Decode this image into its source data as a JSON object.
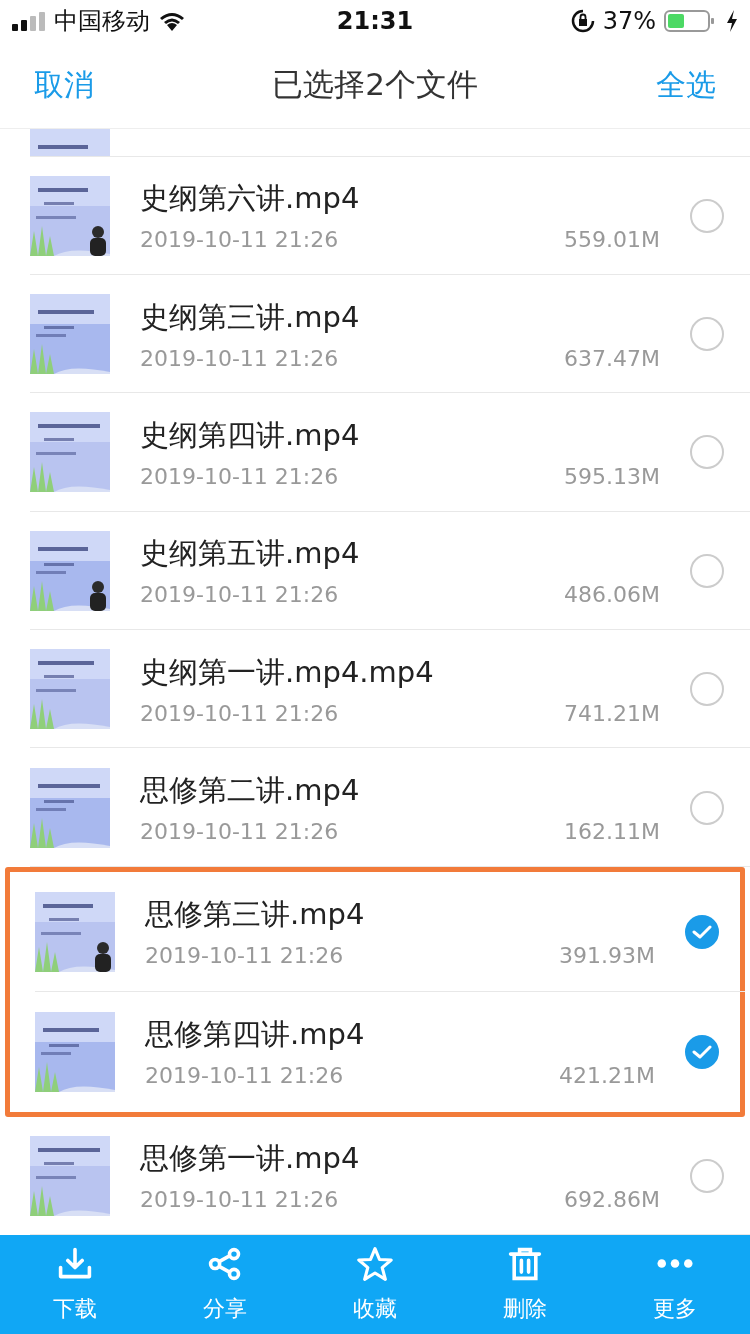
{
  "status_bar": {
    "carrier": "中国移动",
    "time": "21:31",
    "battery": "37%"
  },
  "nav": {
    "cancel": "取消",
    "title": "已选择2个文件",
    "select_all": "全选"
  },
  "files": [
    {
      "name": "史纲第六讲.mp4",
      "date": "2019-10-11 21:26",
      "size": "559.01M",
      "selected": false,
      "highlighted": false
    },
    {
      "name": "史纲第三讲.mp4",
      "date": "2019-10-11 21:26",
      "size": "637.47M",
      "selected": false,
      "highlighted": false
    },
    {
      "name": "史纲第四讲.mp4",
      "date": "2019-10-11 21:26",
      "size": "595.13M",
      "selected": false,
      "highlighted": false
    },
    {
      "name": "史纲第五讲.mp4",
      "date": "2019-10-11 21:26",
      "size": "486.06M",
      "selected": false,
      "highlighted": false
    },
    {
      "name": "史纲第一讲.mp4.mp4",
      "date": "2019-10-11 21:26",
      "size": "741.21M",
      "selected": false,
      "highlighted": false
    },
    {
      "name": "思修第二讲.mp4",
      "date": "2019-10-11 21:26",
      "size": "162.11M",
      "selected": false,
      "highlighted": false
    },
    {
      "name": "思修第三讲.mp4",
      "date": "2019-10-11 21:26",
      "size": "391.93M",
      "selected": true,
      "highlighted": true
    },
    {
      "name": "思修第四讲.mp4",
      "date": "2019-10-11 21:26",
      "size": "421.21M",
      "selected": true,
      "highlighted": true
    },
    {
      "name": "思修第一讲.mp4",
      "date": "2019-10-11 21:26",
      "size": "692.86M",
      "selected": false,
      "highlighted": false
    }
  ],
  "toolbar": [
    {
      "kind": "download",
      "label": "下载"
    },
    {
      "kind": "share",
      "label": "分享"
    },
    {
      "kind": "star",
      "label": "收藏"
    },
    {
      "kind": "trash",
      "label": "删除"
    },
    {
      "kind": "more",
      "label": "更多"
    }
  ]
}
